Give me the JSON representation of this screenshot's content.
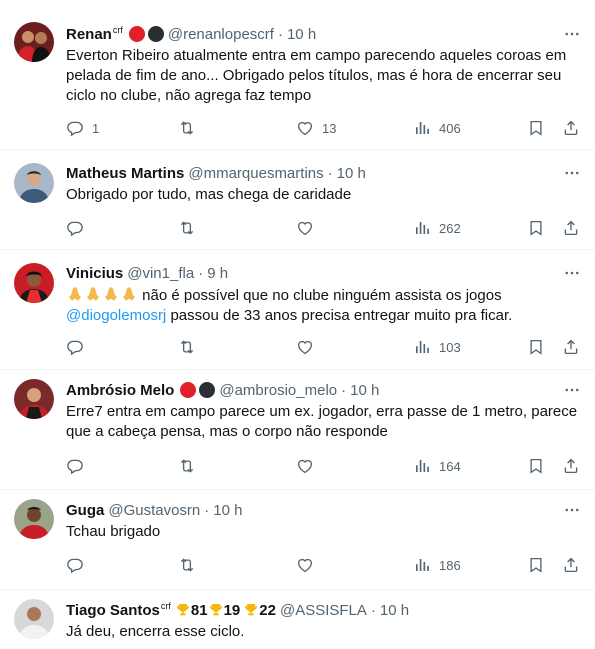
{
  "tweets": [
    {
      "name": "Renan",
      "name_sup": "crf",
      "handle": "@renanlopescrf",
      "sep": "·",
      "time": "10 h",
      "text": "Everton Ribeiro atualmente entra em campo parecendo aqueles coroas em pelada de fim de ano... Obrigado pelos títulos, mas é hora de encerrar seu ciclo no clube, não agrega faz tempo",
      "replies": "1",
      "retweets": "",
      "likes": "13",
      "views": "406"
    },
    {
      "name": "Matheus Martins",
      "handle": "@mmarquesmartins",
      "sep": "·",
      "time": "10 h",
      "text": "Obrigado por tudo, mas chega de caridade",
      "replies": "",
      "retweets": "",
      "likes": "",
      "views": "262"
    },
    {
      "name": "Vinicius",
      "handle": "@vin1_fla",
      "sep": "·",
      "time": "9 h",
      "text_line1": " não é possível que no clube ninguém assista os jogos",
      "mention": "@diogolemosrj",
      "text_line2": " passou de 33 anos precisa entregar muito pra ficar.",
      "replies": "",
      "retweets": "",
      "likes": "",
      "views": "103"
    },
    {
      "name": "Ambrósio Melo",
      "handle": "@ambrosio_melo",
      "sep": "·",
      "time": "10 h",
      "text": "Erre7 entra em campo parece um ex. jogador, erra passe de 1 metro, parece que a cabeça pensa, mas o corpo não responde",
      "replies": "",
      "retweets": "",
      "likes": "",
      "views": "164"
    },
    {
      "name": "Guga",
      "handle": "@Gustavosrn",
      "sep": "·",
      "time": "10 h",
      "text": "Tchau brigado",
      "replies": "",
      "retweets": "",
      "likes": "",
      "views": "186"
    },
    {
      "name": "Tiago Santos",
      "name_sup": "crf",
      "trophy_counts": [
        "81",
        "19",
        "22"
      ],
      "handle": "@ASSISFLA",
      "sep": "·",
      "time": "10 h",
      "text": "Já deu, encerra esse ciclo."
    }
  ],
  "colors": {
    "accent": "#1d9bf0",
    "flamengo_red": "#e0202a",
    "secondary_text": "#536471"
  },
  "icons": [
    "reply-icon",
    "retweet-icon",
    "like-icon",
    "views-icon",
    "bookmark-icon",
    "share-icon",
    "more-icon"
  ]
}
